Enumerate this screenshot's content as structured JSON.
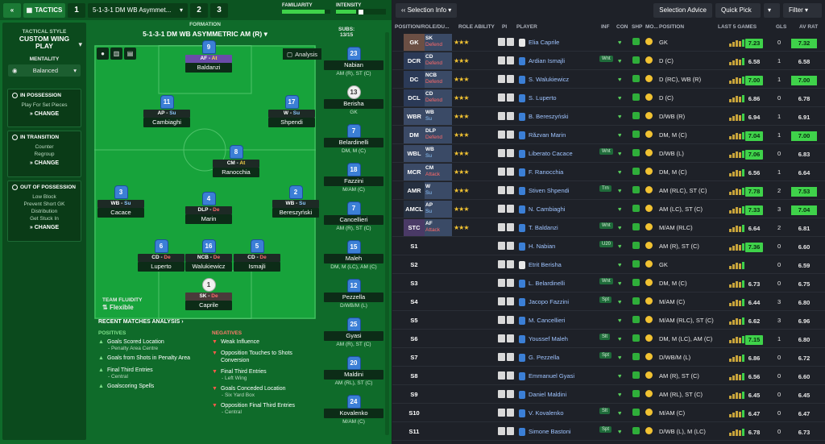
{
  "topbar": {
    "tactics": "TACTICS",
    "slot1": "1",
    "tactic_name": "5-1-3-1 DM WB Asymmet...",
    "slot2": "2",
    "slot3": "3",
    "familiarity": "FAMILIARITY",
    "intensity": "INTENSITY"
  },
  "sidebar": {
    "style_label": "TACTICAL STYLE",
    "style_value": "CUSTOM WING PLAY",
    "mentality_label": "MENTALITY",
    "mentality_value": "Balanced",
    "in_possession": {
      "title": "IN POSSESSION",
      "items": [
        "Play For Set Pieces"
      ],
      "change": "CHANGE"
    },
    "in_transition": {
      "title": "IN TRANSITION",
      "items": [
        "Counter",
        "Regroup"
      ],
      "change": "CHANGE"
    },
    "out_possession": {
      "title": "OUT OF POSSESSION",
      "items": [
        "Low Block",
        "Prevent Short GK Distribution",
        "Get Stuck In"
      ],
      "change": "CHANGE"
    }
  },
  "formation": {
    "label": "FORMATION",
    "name": "5-1-3-1 DM WB ASYMMETRIC AM (R)",
    "subs_label": "SUBS:",
    "subs_count": "13/15",
    "analysis": "Analysis"
  },
  "pitch_players": [
    {
      "num": "9",
      "role": "AF",
      "duty": "At",
      "name": "Baldanzi"
    },
    {
      "num": "11",
      "role": "AP",
      "duty": "Su",
      "name": "Cambiaghi"
    },
    {
      "num": "17",
      "role": "W",
      "duty": "Su",
      "name": "Shpendi"
    },
    {
      "num": "8",
      "role": "CM",
      "duty": "At",
      "name": "Ranocchia"
    },
    {
      "num": "3",
      "role": "WB",
      "duty": "Su",
      "name": "Cacace"
    },
    {
      "num": "4",
      "role": "DLP",
      "duty": "De",
      "name": "Marin"
    },
    {
      "num": "2",
      "role": "WB",
      "duty": "Su",
      "name": "Bereszyński"
    },
    {
      "num": "6",
      "role": "CD",
      "duty": "De",
      "name": "Luperto"
    },
    {
      "num": "16",
      "role": "NCB",
      "duty": "De",
      "name": "Walukiewicz"
    },
    {
      "num": "5",
      "role": "CD",
      "duty": "De",
      "name": "Ismajli"
    },
    {
      "num": "1",
      "role": "SK",
      "duty": "De",
      "name": "Caprile"
    }
  ],
  "subs": [
    {
      "num": "23",
      "name": "Nabian",
      "pos": "AM (R), ST (C)"
    },
    {
      "num": "13",
      "name": "Berisha",
      "pos": "GK"
    },
    {
      "num": "7",
      "name": "Belardinelli",
      "pos": "DM, M (C)"
    },
    {
      "num": "18",
      "name": "Fazzini",
      "pos": "M/AM (C)"
    },
    {
      "num": "7",
      "name": "Cancellieri",
      "pos": "AM (R), ST (C)"
    },
    {
      "num": "15",
      "name": "Maleh",
      "pos": "DM, M (LC), AM (C)"
    },
    {
      "num": "12",
      "name": "Pezzella",
      "pos": "D/WB/M (L)"
    },
    {
      "num": "25",
      "name": "Gyasi",
      "pos": "AM (R), ST (C)"
    },
    {
      "num": "20",
      "name": "Maldini",
      "pos": "AM (RL), ST (C)"
    },
    {
      "num": "24",
      "name": "Kovalenko",
      "pos": "M/AM (C)"
    }
  ],
  "fluidity": {
    "label": "TEAM FLUIDITY",
    "value": "Flexible"
  },
  "analysis": {
    "title": "RECENT MATCHES ANALYSIS",
    "positives_label": "POSITIVES",
    "negatives_label": "NEGATIVES",
    "positives": [
      {
        "text": "Goals Scored Location",
        "sub": "- Penalty Area Centre"
      },
      {
        "text": "Goals from Shots in Penalty Area",
        "sub": ""
      },
      {
        "text": "Final Third Entries",
        "sub": "- Central"
      },
      {
        "text": "Goalscoring Spells",
        "sub": ""
      }
    ],
    "negatives": [
      {
        "text": "Weak Influence",
        "sub": ""
      },
      {
        "text": "Opposition Touches to Shots Conversion",
        "sub": ""
      },
      {
        "text": "Final Third Entries",
        "sub": "- Left Wing"
      },
      {
        "text": "Goals Conceded Location",
        "sub": "- Six Yard Box"
      },
      {
        "text": "Opposition Final Third Entries",
        "sub": "- Central"
      }
    ]
  },
  "right_top": {
    "selection_info": "Selection Info",
    "selection_advice": "Selection Advice",
    "quick_pick": "Quick Pick",
    "filter": "Filter"
  },
  "columns": {
    "pos": "POSITION/ROLE/DU...",
    "ability": "ROLE ABILITY",
    "pi": "PI",
    "player": "PLAYER",
    "inf": "INF",
    "con": "CON",
    "shp": "SHP",
    "mo": "MO...",
    "position": "POSITION",
    "last5": "LAST 5 GAMES",
    "gls": "GLS",
    "avrat": "AV RAT"
  },
  "rows": [
    {
      "slot": "GK",
      "role": "SK",
      "duty": "Defend",
      "stars": "★★★",
      "name": "Elia Caprile",
      "inf": "",
      "pos": "GK",
      "rat": "7.23",
      "gls": "0",
      "av": "7.32"
    },
    {
      "slot": "DCR",
      "role": "CD",
      "duty": "Defend",
      "stars": "★★★",
      "name": "Ardian Ismajli",
      "inf": "Wnt",
      "pos": "D (C)",
      "rat": "6.58",
      "gls": "1",
      "av": "6.58"
    },
    {
      "slot": "DC",
      "role": "NCB",
      "duty": "Defend",
      "stars": "★★★",
      "name": "S. Walukiewicz",
      "inf": "",
      "pos": "D (RC), WB (R)",
      "rat": "7.00",
      "gls": "1",
      "av": "7.00"
    },
    {
      "slot": "DCL",
      "role": "CD",
      "duty": "Defend",
      "stars": "★★★",
      "name": "S. Luperto",
      "inf": "",
      "pos": "D (C)",
      "rat": "6.86",
      "gls": "0",
      "av": "6.78"
    },
    {
      "slot": "WBR",
      "role": "WB",
      "duty": "Su",
      "stars": "★★★",
      "name": "B. Bereszyński",
      "inf": "",
      "pos": "D/WB (R)",
      "rat": "6.94",
      "gls": "1",
      "av": "6.91"
    },
    {
      "slot": "DM",
      "role": "DLP",
      "duty": "Defend",
      "stars": "★★★",
      "name": "Răzvan Marin",
      "inf": "",
      "pos": "DM, M (C)",
      "rat": "7.04",
      "gls": "1",
      "av": "7.00"
    },
    {
      "slot": "WBL",
      "role": "WB",
      "duty": "Su",
      "stars": "★★★",
      "name": "Liberato Cacace",
      "inf": "Wnt",
      "pos": "D/WB (L)",
      "rat": "7.06",
      "gls": "0",
      "av": "6.83"
    },
    {
      "slot": "MCR",
      "role": "CM",
      "duty": "Attack",
      "stars": "★★★",
      "name": "F. Ranocchia",
      "inf": "",
      "pos": "DM, M (C)",
      "rat": "6.56",
      "gls": "1",
      "av": "6.64"
    },
    {
      "slot": "AMR",
      "role": "W",
      "duty": "Su",
      "stars": "★★★",
      "name": "Stiven Shpendi",
      "inf": "Trn",
      "pos": "AM (RLC), ST (C)",
      "rat": "7.78",
      "gls": "2",
      "av": "7.53"
    },
    {
      "slot": "AMCL",
      "role": "AP",
      "duty": "Su",
      "stars": "★★★",
      "name": "N. Cambiaghi",
      "inf": "",
      "pos": "AM (LC), ST (C)",
      "rat": "7.33",
      "gls": "3",
      "av": "7.04"
    },
    {
      "slot": "STC",
      "role": "AF",
      "duty": "Attack",
      "stars": "★★★",
      "name": "T. Baldanzi",
      "inf": "Wnt",
      "pos": "M/AM (RLC)",
      "rat": "6.64",
      "gls": "2",
      "av": "6.81"
    },
    {
      "slot": "S1",
      "role": "",
      "duty": "",
      "stars": "",
      "name": "H. Nabian",
      "inf": "U20",
      "pos": "AM (R), ST (C)",
      "rat": "7.36",
      "gls": "0",
      "av": "6.60"
    },
    {
      "slot": "S2",
      "role": "",
      "duty": "",
      "stars": "",
      "name": "Etrit Berisha",
      "inf": "",
      "pos": "GK",
      "rat": "",
      "gls": "0",
      "av": "6.59"
    },
    {
      "slot": "S3",
      "role": "",
      "duty": "",
      "stars": "",
      "name": "L. Belardinelli",
      "inf": "Wnt",
      "pos": "DM, M (C)",
      "rat": "6.73",
      "gls": "0",
      "av": "6.75"
    },
    {
      "slot": "S4",
      "role": "",
      "duty": "",
      "stars": "",
      "name": "Jacopo Fazzini",
      "inf": "Spt",
      "pos": "M/AM (C)",
      "rat": "6.44",
      "gls": "3",
      "av": "6.80"
    },
    {
      "slot": "S5",
      "role": "",
      "duty": "",
      "stars": "",
      "name": "M. Cancellieri",
      "inf": "",
      "pos": "M/AM (RLC), ST (C)",
      "rat": "6.62",
      "gls": "3",
      "av": "6.96"
    },
    {
      "slot": "S6",
      "role": "",
      "duty": "",
      "stars": "",
      "name": "Youssef Maleh",
      "inf": "Slt",
      "pos": "DM, M (LC), AM (C)",
      "rat": "7.15",
      "gls": "1",
      "av": "6.80"
    },
    {
      "slot": "S7",
      "role": "",
      "duty": "",
      "stars": "",
      "name": "G. Pezzella",
      "inf": "Spt",
      "pos": "D/WB/M (L)",
      "rat": "6.86",
      "gls": "0",
      "av": "6.72"
    },
    {
      "slot": "S8",
      "role": "",
      "duty": "",
      "stars": "",
      "name": "Emmanuel Gyasi",
      "inf": "",
      "pos": "AM (R), ST (C)",
      "rat": "6.56",
      "gls": "0",
      "av": "6.60"
    },
    {
      "slot": "S9",
      "role": "",
      "duty": "",
      "stars": "",
      "name": "Daniel Maldini",
      "inf": "",
      "pos": "AM (RL), ST (C)",
      "rat": "6.45",
      "gls": "0",
      "av": "6.45"
    },
    {
      "slot": "S10",
      "role": "",
      "duty": "",
      "stars": "",
      "name": "V. Kovalenko",
      "inf": "Slt",
      "pos": "M/AM (C)",
      "rat": "6.47",
      "gls": "0",
      "av": "6.47"
    },
    {
      "slot": "S11",
      "role": "",
      "duty": "",
      "stars": "",
      "name": "Simone Bastoni",
      "inf": "Spt",
      "pos": "D/WB (L), M (LC)",
      "rat": "6.78",
      "gls": "0",
      "av": "6.73"
    }
  ],
  "colors": {
    "pitch": "#17a33b",
    "panel": "#0f6b2a",
    "accent_green": "#3fd24a"
  }
}
